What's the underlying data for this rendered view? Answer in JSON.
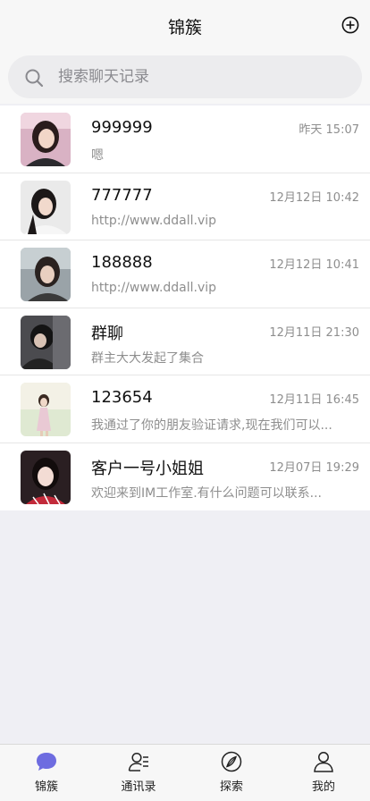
{
  "header": {
    "title": "锦簇",
    "add_icon": "plus-circle-icon"
  },
  "search": {
    "placeholder": "搜索聊天记录",
    "icon": "search-icon"
  },
  "chats": [
    {
      "name": "999999",
      "time": "昨天 15:07",
      "preview": "嗯"
    },
    {
      "name": "777777",
      "time": "12月12日 10:42",
      "preview": "http://www.ddall.vip"
    },
    {
      "name": "188888",
      "time": "12月12日 10:41",
      "preview": "http://www.ddall.vip"
    },
    {
      "name": "群聊",
      "time": "12月11日 21:30",
      "preview": "群主大大发起了集合"
    },
    {
      "name": "123654",
      "time": "12月11日 16:45",
      "preview": "我通过了你的朋友验证请求,现在我们可以..."
    },
    {
      "name": "客户一号小姐姐",
      "time": "12月07日 19:29",
      "preview": "欢迎来到IM工作室.有什么问题可以联系..."
    }
  ],
  "tabs": [
    {
      "label": "锦簇",
      "icon": "chat-bubble-icon",
      "active": true
    },
    {
      "label": "通讯录",
      "icon": "contacts-icon",
      "active": false
    },
    {
      "label": "探索",
      "icon": "compass-icon",
      "active": false
    },
    {
      "label": "我的",
      "icon": "person-icon",
      "active": false
    }
  ],
  "colors": {
    "accent": "#6e6ce0",
    "header_bg": "#f7f7f7",
    "page_bg": "#efeff4",
    "secondary_text": "#8e8e8e"
  }
}
